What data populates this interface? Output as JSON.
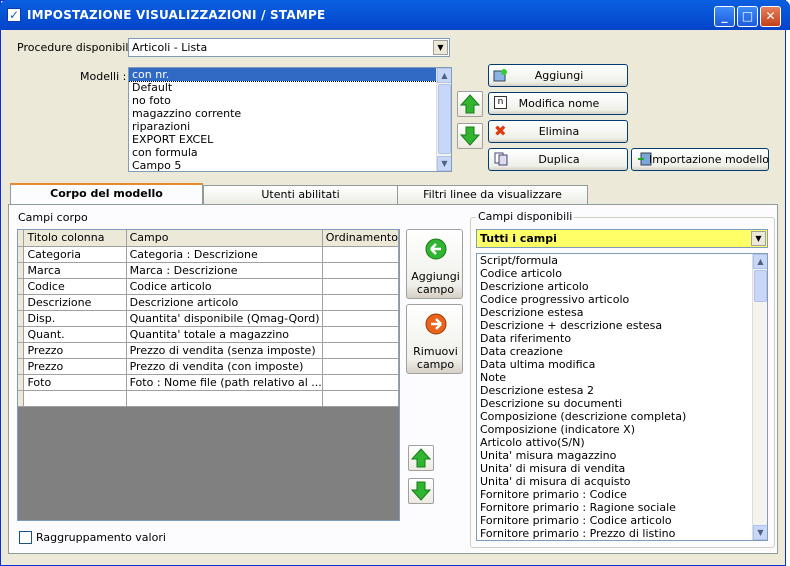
{
  "window": {
    "title": "IMPOSTAZIONE VISUALIZZAZIONI / STAMPE",
    "controls": {
      "minimize": "_",
      "maximize": "□",
      "close": "✕"
    }
  },
  "procedure": {
    "label": "Procedure disponibili :",
    "selected": "Articoli - Lista"
  },
  "modelli": {
    "label": "Modelli :",
    "items": [
      "con nr.",
      "Default",
      "no foto",
      "magazzino corrente",
      "riparazioni",
      "EXPORT EXCEL",
      "con formula",
      "Campo 5"
    ],
    "selected_index": 0
  },
  "actions": {
    "aggiungi": "Aggiungi",
    "modifica_nome": "Modifica nome",
    "elimina": "Elimina",
    "duplica": "Duplica",
    "importazione_modello": "Importazione modello"
  },
  "tabs": [
    {
      "label": "Corpo del modello",
      "active": true
    },
    {
      "label": "Utenti abilitati",
      "active": false
    },
    {
      "label": "Filtri linee da visualizzare",
      "active": false
    }
  ],
  "campi_corpo": {
    "label": "Campi corpo",
    "columns": [
      "Titolo colonna",
      "Campo",
      "Ordinamento"
    ],
    "rows": [
      [
        "Categoria",
        "Categoria : Descrizione",
        ""
      ],
      [
        "Marca",
        "Marca : Descrizione",
        ""
      ],
      [
        "Codice",
        "Codice articolo",
        ""
      ],
      [
        "Descrizione",
        "Descrizione articolo",
        ""
      ],
      [
        "Disp.",
        "Quantita' disponibile (Qmag-Qord)",
        ""
      ],
      [
        "Quant.",
        "Quantita' totale a magazzino",
        ""
      ],
      [
        "Prezzo",
        "Prezzo di vendita (senza imposte)",
        ""
      ],
      [
        "Prezzo",
        "Prezzo di vendita (con imposte)",
        ""
      ],
      [
        "Foto",
        "Foto : Nome file (path relativo al ...",
        ""
      ],
      [
        "",
        "",
        ""
      ]
    ]
  },
  "field_actions": {
    "aggiungi_campo": [
      "Aggiungi",
      "campo"
    ],
    "rimuovi_campo": [
      "Rimuovi",
      "campo"
    ]
  },
  "campi_disponibili": {
    "label": "Campi disponibili",
    "filter": "Tutti i campi",
    "items": [
      "Script/formula",
      "Codice articolo",
      "Descrizione articolo",
      "Codice progressivo articolo",
      "Descrizione estesa",
      "Descrizione + descrizione estesa",
      "Data riferimento",
      "Data creazione",
      "Data ultima modifica",
      "Note",
      "Descrizione estesa 2",
      "Descrizione su documenti",
      "Composizione (descrizione completa)",
      "Composizione (indicatore X)",
      "Articolo attivo(S/N)",
      "Unita' misura magazzino",
      "Unita' di misura di vendita",
      "Unita' di misura di acquisto",
      "Fornitore primario : Codice",
      "Fornitore primario : Ragione sociale",
      "Fornitore primario : Codice articolo",
      "Fornitore primario : Prezzo di listino"
    ]
  },
  "raggruppamento": {
    "label": "Raggruppamento valori",
    "checked": false
  },
  "colors": {
    "title_bar": "#0856d7",
    "selection": "#316ac5",
    "filter_bg": "#ffff66",
    "arrow_green": "#2fb52f",
    "arrow_orange": "#e8631c"
  }
}
